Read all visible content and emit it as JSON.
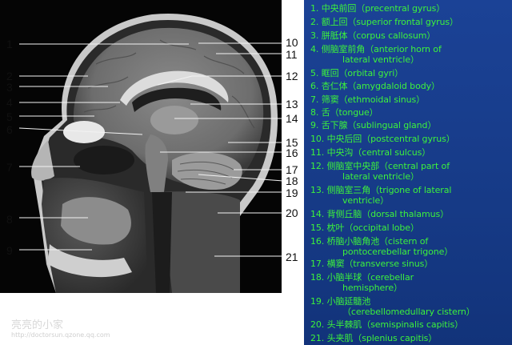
{
  "image": {
    "labels": [
      "1",
      "2",
      "3",
      "4",
      "5",
      "6",
      "7",
      "8",
      "9",
      "10",
      "11",
      "12",
      "13",
      "14",
      "15",
      "16",
      "17",
      "18",
      "19",
      "20",
      "21"
    ]
  },
  "legend": [
    {
      "num": "1.",
      "zh": "中央前回",
      "en": "precentral gyrus",
      "cont": ""
    },
    {
      "num": "2.",
      "zh": "额上回",
      "en": "superior frontal gyrus",
      "cont": ""
    },
    {
      "num": "3.",
      "zh": "胼胝体",
      "en": "corpus callosum",
      "cont": ""
    },
    {
      "num": "4.",
      "zh": "侧脑室前角",
      "en": "anterior horn of",
      "cont": "lateral ventricle"
    },
    {
      "num": "5.",
      "zh": "眶回",
      "en": "orbital gyri",
      "cont": ""
    },
    {
      "num": "6.",
      "zh": "杏仁体",
      "en": "amygdaloid body",
      "cont": ""
    },
    {
      "num": "7.",
      "zh": "筛窦",
      "en": "ethmoidal sinus",
      "cont": ""
    },
    {
      "num": "8.",
      "zh": "舌",
      "en": "tongue",
      "cont": ""
    },
    {
      "num": "9.",
      "zh": "舌下腺",
      "en": "sublingual gland",
      "cont": ""
    },
    {
      "num": "10.",
      "zh": "中央后回",
      "en": "postcentral gyrus",
      "cont": ""
    },
    {
      "num": "11.",
      "zh": "中央沟",
      "en": "central sulcus",
      "cont": ""
    },
    {
      "num": "12.",
      "zh": "侧脑室中央部",
      "en": "central part of",
      "cont": "lateral ventricle"
    },
    {
      "num": "13.",
      "zh": "侧脑室三角",
      "en": "trigone of lateral",
      "cont": "ventricle"
    },
    {
      "num": "14.",
      "zh": "背侧丘脑",
      "en": "dorsal thalamus",
      "cont": ""
    },
    {
      "num": "15.",
      "zh": "枕叶",
      "en": "occipital lobe",
      "cont": ""
    },
    {
      "num": "16.",
      "zh": "桥脑小脑角池",
      "en": "cistern of",
      "cont": "pontocerebellar trigone"
    },
    {
      "num": "17.",
      "zh": "横窦",
      "en": "transverse sinus",
      "cont": ""
    },
    {
      "num": "18.",
      "zh": "小脑半球",
      "en": "cerebellar",
      "cont": "hemisphere"
    },
    {
      "num": "19.",
      "zh": "小脑延髓池",
      "en": "",
      "cont": "cerebellomedullary cistern"
    },
    {
      "num": "20.",
      "zh": "头半棘肌",
      "en": "semispinalis capitis",
      "cont": ""
    },
    {
      "num": "21.",
      "zh": "头夹肌",
      "en": "splenius capitis",
      "cont": ""
    }
  ],
  "watermark": {
    "name": "亮亮的小家",
    "url": "http://doctorsun.qzone.qq.com"
  },
  "colors": {
    "background": "#1a3d8f",
    "legend_text": "#3cf23c"
  }
}
